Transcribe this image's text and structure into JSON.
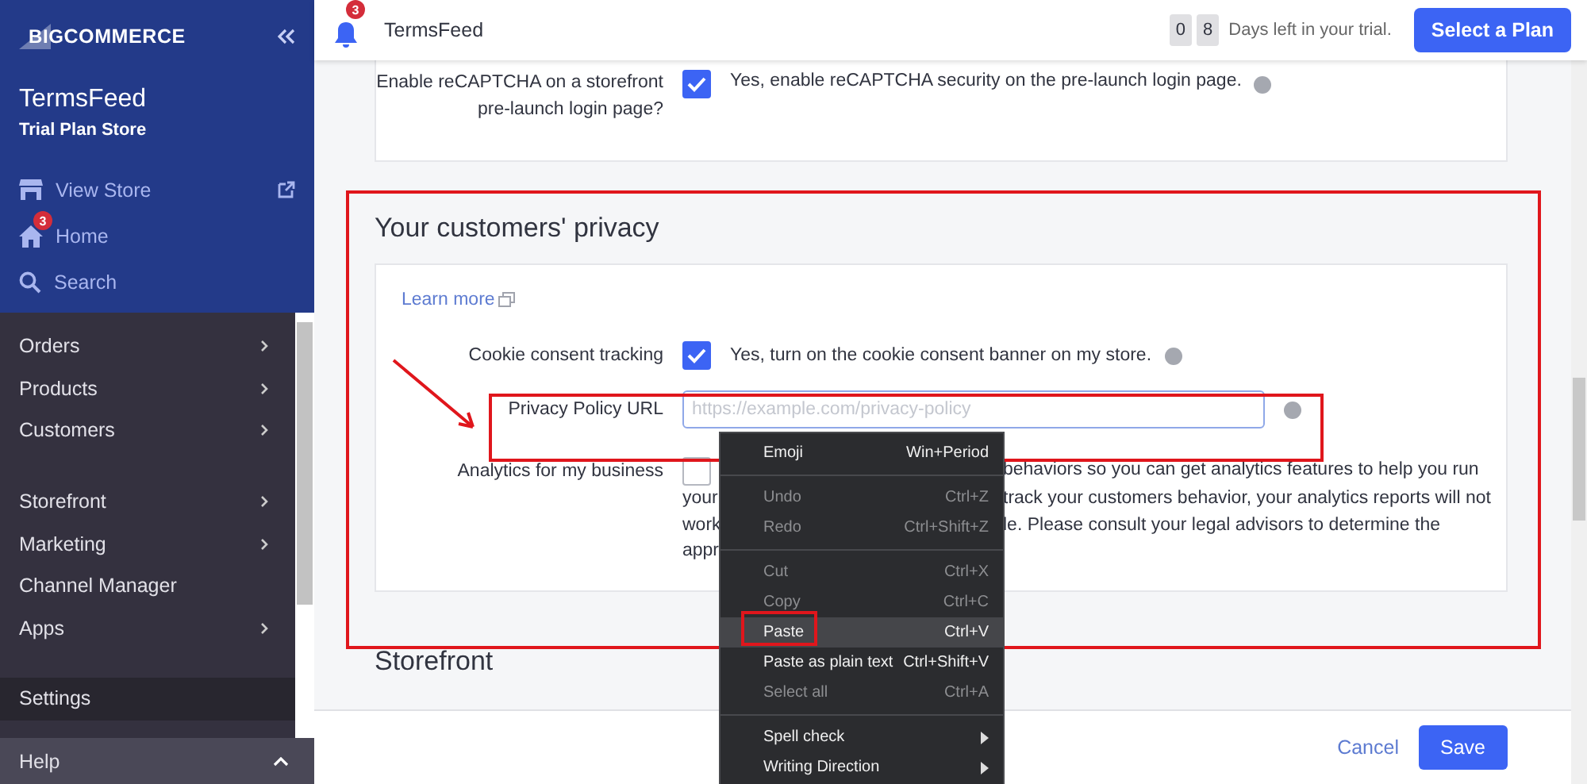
{
  "sidebar": {
    "logo": {
      "mark": "BIG",
      "word": "COMMERCE"
    },
    "store_name": "TermsFeed",
    "plan": "Trial Plan Store",
    "top_links": [
      {
        "kind": "store",
        "label": "View Store",
        "external": true
      },
      {
        "kind": "home",
        "label": "Home",
        "badge": "3"
      },
      {
        "kind": "search",
        "label": "Search"
      }
    ],
    "nav_groups": [
      [
        {
          "label": "Orders",
          "has_submenu": true,
          "selected": false
        },
        {
          "label": "Products",
          "has_submenu": true,
          "selected": false
        },
        {
          "label": "Customers",
          "has_submenu": true,
          "selected": false
        }
      ],
      [
        {
          "label": "Storefront",
          "has_submenu": true,
          "selected": false
        },
        {
          "label": "Marketing",
          "has_submenu": true,
          "selected": false
        },
        {
          "label": "Channel Manager",
          "has_submenu": false,
          "selected": false
        },
        {
          "label": "Apps",
          "has_submenu": true,
          "selected": false
        }
      ],
      [
        {
          "label": "Settings",
          "has_submenu": false,
          "selected": true
        }
      ]
    ],
    "help": {
      "label": "Help",
      "expanded": true
    }
  },
  "topbar": {
    "notification_count": "3",
    "store_name": "TermsFeed",
    "trial_digits": [
      "0",
      "8"
    ],
    "trial_text": "Days left in your trial.",
    "plan_button": "Select a Plan"
  },
  "recaptcha": {
    "label": "Enable reCAPTCHA on a storefront pre-launch login page?",
    "checked": true,
    "text": "Yes, enable reCAPTCHA security on the pre-launch login page."
  },
  "privacy": {
    "title": "Your customers' privacy",
    "learn_more": "Learn more",
    "cookie": {
      "label": "Cookie consent tracking",
      "checked": true,
      "text": "Yes, turn on the cookie consent banner on my store."
    },
    "policy_url": {
      "label": "Privacy Policy URL",
      "placeholder": "https://example.com/privacy-policy"
    },
    "analytics": {
      "label": "Analytics for my business",
      "checked": false,
      "lines": [
        {
          "right": "behaviors so you can get analytics features to help you run"
        },
        {
          "left": "your",
          "right": "track your customers behavior, your analytics reports will not"
        },
        {
          "left": "work",
          "right": "le. Please consult your legal advisors to determine the"
        },
        {
          "left": "appr"
        }
      ]
    }
  },
  "storefront": {
    "title": "Storefront"
  },
  "footer": {
    "cancel": "Cancel",
    "save": "Save"
  },
  "context_menu": [
    {
      "kind": "item",
      "label": "Emoji",
      "shortcut": "Win+Period",
      "disabled": false,
      "selected": false
    },
    {
      "kind": "separator"
    },
    {
      "kind": "item",
      "label": "Undo",
      "shortcut": "Ctrl+Z",
      "disabled": true,
      "selected": false
    },
    {
      "kind": "item",
      "label": "Redo",
      "shortcut": "Ctrl+Shift+Z",
      "disabled": true,
      "selected": false
    },
    {
      "kind": "separator"
    },
    {
      "kind": "item",
      "label": "Cut",
      "shortcut": "Ctrl+X",
      "disabled": true,
      "selected": false
    },
    {
      "kind": "item",
      "label": "Copy",
      "shortcut": "Ctrl+C",
      "disabled": true,
      "selected": false
    },
    {
      "kind": "item",
      "label": "Paste",
      "shortcut": "Ctrl+V",
      "disabled": false,
      "selected": true
    },
    {
      "kind": "item",
      "label": "Paste as plain text",
      "shortcut": "Ctrl+Shift+V",
      "disabled": false,
      "selected": false
    },
    {
      "kind": "item",
      "label": "Select all",
      "shortcut": "Ctrl+A",
      "disabled": true,
      "selected": false
    },
    {
      "kind": "separator"
    },
    {
      "kind": "submenu",
      "label": "Spell check",
      "disabled": false,
      "selected": false
    },
    {
      "kind": "submenu",
      "label": "Writing Direction",
      "disabled": false,
      "selected": false
    }
  ]
}
